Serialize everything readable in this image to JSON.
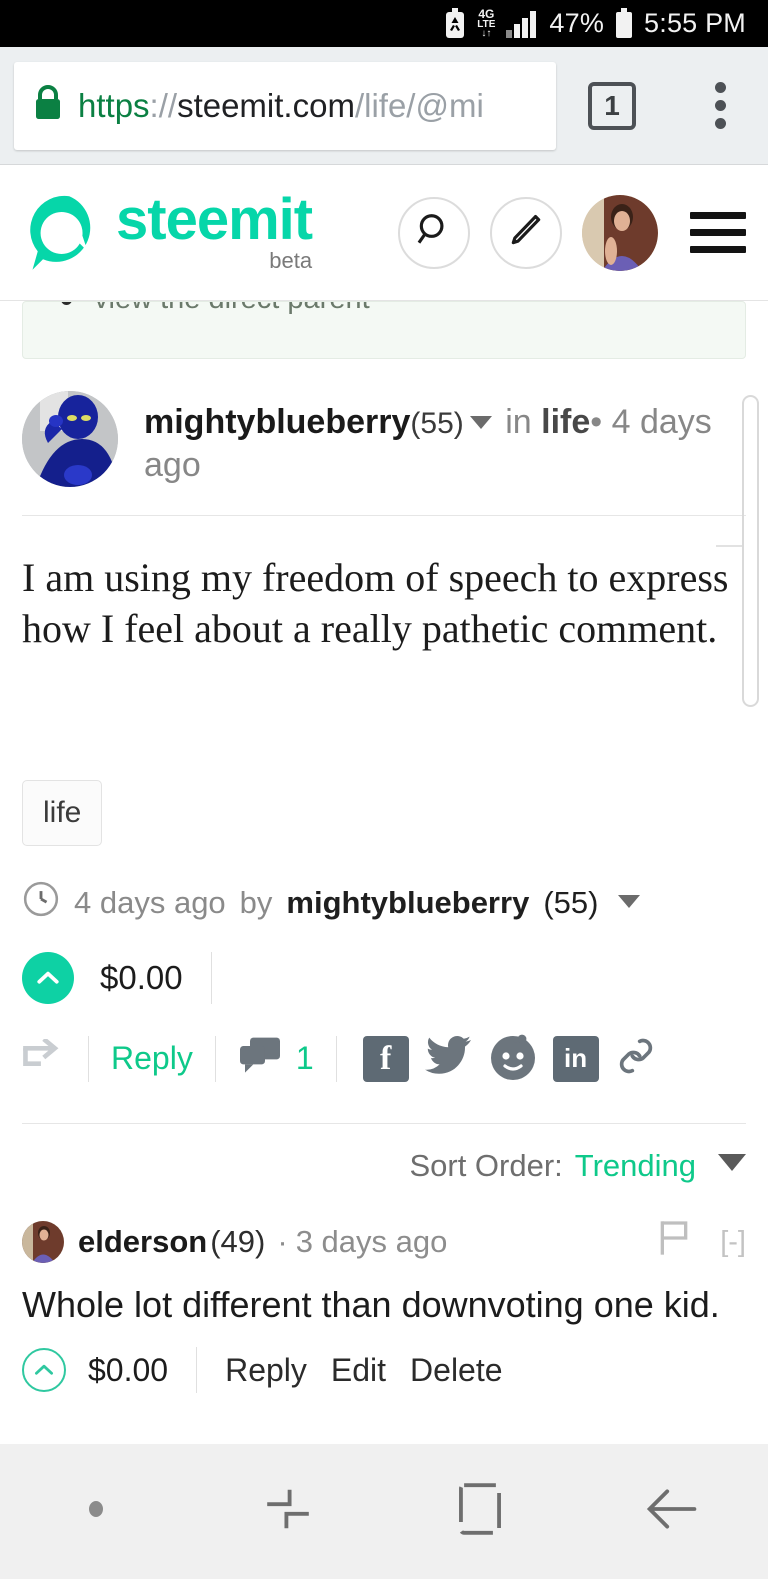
{
  "status_bar": {
    "battery_saver_icon": "battery-recycle-icon",
    "network_icon": "4g-lte-icon",
    "network_label_top": "4G",
    "network_label_bottom": "LTE",
    "signal_icon": "signal-bars-icon",
    "battery_percent": "47%",
    "battery_icon": "battery-icon",
    "time": "5:55 PM"
  },
  "browser": {
    "lock_icon": "lock-icon",
    "url_scheme": "https",
    "url_separator": "://",
    "url_host": "steemit.com",
    "url_path": "/life/@mi",
    "url_full": "https://steemit.com/life/@mig",
    "tab_count": "1",
    "menu_icon": "kebab-menu-icon"
  },
  "site_header": {
    "brand_name": "steemit",
    "brand_sub": "beta",
    "search_icon": "search-icon",
    "compose_icon": "pencil-icon",
    "avatar_icon": "user-avatar",
    "menu_icon": "hamburger-menu-icon",
    "brand_color": "#06d6a9"
  },
  "parent_note": {
    "text": "view the direct parent"
  },
  "post": {
    "author": "mightyblueberry",
    "reputation": "(55)",
    "in_label": "in",
    "category": "life",
    "dot": "•",
    "age": "4 days ago",
    "body": "I am using my freedom of speech to express how I feel about a really pathetic comment.",
    "tags": [
      "life"
    ],
    "byline_clock_icon": "clock-icon",
    "byline_age": "4 days ago",
    "byline_by": "by",
    "byline_author": "mightyblueberry",
    "byline_rep": "(55)",
    "payout": "$0.00",
    "upvote_icon": "upvote-chevron-icon",
    "resteem_icon": "resteem-icon",
    "reply_label": "Reply",
    "comment_icon": "comment-bubble-icon",
    "comment_count": "1",
    "share": [
      {
        "name": "facebook-share-icon",
        "glyph": "f"
      },
      {
        "name": "twitter-share-icon",
        "glyph": ""
      },
      {
        "name": "reddit-share-icon",
        "glyph": ""
      },
      {
        "name": "linkedin-share-icon",
        "glyph": "in"
      },
      {
        "name": "copy-link-icon",
        "glyph": ""
      }
    ]
  },
  "sort": {
    "label": "Sort Order:",
    "value": "Trending",
    "caret_icon": "chevron-down-icon"
  },
  "comments": [
    {
      "author": "elderson",
      "reputation": "(49)",
      "separator": "·",
      "age": "3 days ago",
      "flag_icon": "flag-icon",
      "collapse": "[-]",
      "body": "Whole lot different than downvoting one kid.",
      "payout": "$0.00",
      "upvote_icon": "upvote-chevron-icon",
      "actions": [
        "Reply",
        "Edit",
        "Delete"
      ]
    }
  ],
  "nav_bar": {
    "dot_icon": "menu-dot-icon",
    "recents_icon": "recent-apps-icon",
    "home_icon": "home-icon",
    "back_icon": "back-arrow-icon"
  }
}
